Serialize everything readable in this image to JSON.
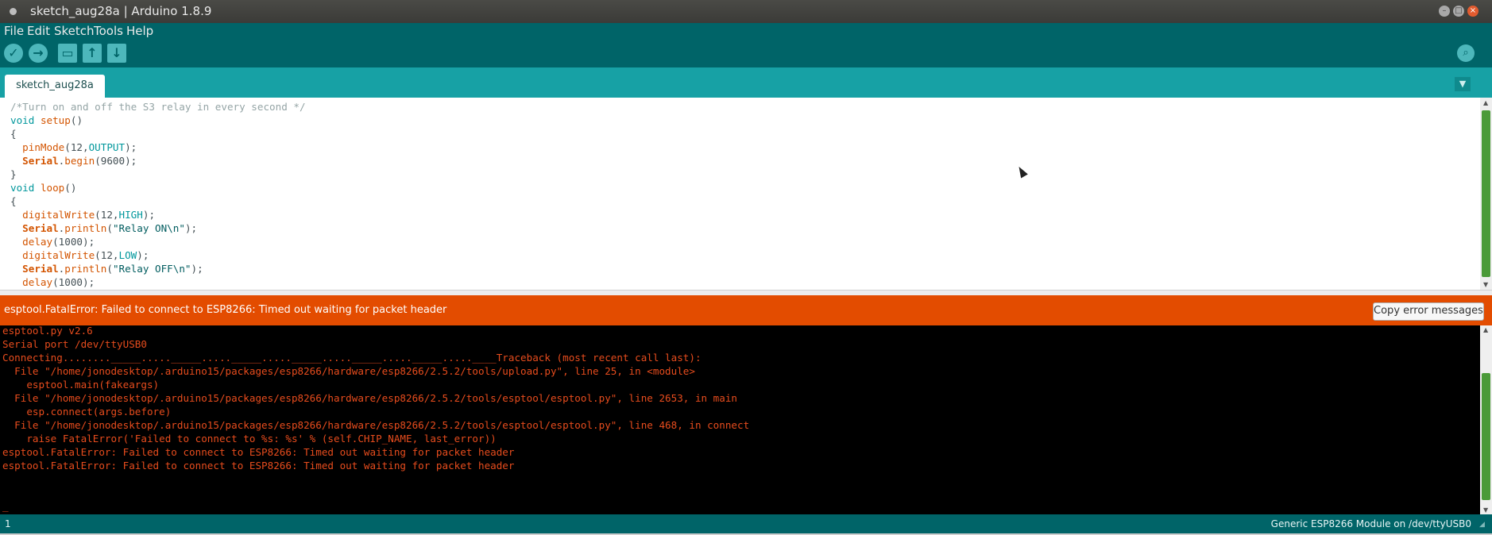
{
  "window": {
    "title": "sketch_aug28a | Arduino 1.8.9"
  },
  "window_controls": {
    "minimize": "–",
    "maximize": "□",
    "close": "×"
  },
  "menu": [
    {
      "label": "File"
    },
    {
      "label": "Edit"
    },
    {
      "label": "Sketch"
    },
    {
      "label": "Tools"
    },
    {
      "label": "Help"
    }
  ],
  "toolbar": {
    "verify_glyph": "✓",
    "upload_glyph": "→",
    "new_glyph": "▭",
    "open_glyph": "↑",
    "save_glyph": "↓",
    "serial_glyph": "⌕"
  },
  "tabs": {
    "active": "sketch_aug28a",
    "menu_glyph": "▼"
  },
  "editor": {
    "code_lines": [
      "/*Turn on and off the S3 relay in every second */",
      "void setup()",
      "{",
      "  pinMode(12,OUTPUT);",
      "  Serial.begin(9600);",
      "}",
      "void loop()",
      "{",
      "  digitalWrite(12,HIGH);",
      "  Serial.println(\"Relay ON\\n\");",
      "  delay(1000);",
      "  digitalWrite(12,LOW);",
      "  Serial.println(\"Relay OFF\\n\");",
      "  delay(1000);"
    ]
  },
  "error": {
    "message": "esptool.FatalError: Failed to connect to ESP8266: Timed out waiting for packet header",
    "copy_button": "Copy error messages"
  },
  "console": {
    "lines": [
      "esptool.py v2.6",
      "Serial port /dev/ttyUSB0",
      "Connecting........_____....._____....._____....._____....._____....._____.....____Traceback (most recent call last):",
      "  File \"/home/jonodesktop/.arduino15/packages/esp8266/hardware/esp8266/2.5.2/tools/upload.py\", line 25, in <module>",
      "    esptool.main(fakeargs)",
      "  File \"/home/jonodesktop/.arduino15/packages/esp8266/hardware/esp8266/2.5.2/tools/esptool/esptool.py\", line 2653, in main",
      "    esp.connect(args.before)",
      "  File \"/home/jonodesktop/.arduino15/packages/esp8266/hardware/esp8266/2.5.2/tools/esptool/esptool.py\", line 468, in connect",
      "    raise FatalError('Failed to connect to %s: %s' % (self.CHIP_NAME, last_error))",
      "esptool.FatalError: Failed to connect to ESP8266: Timed out waiting for packet header",
      "esptool.FatalError: Failed to connect to ESP8266: Timed out waiting for packet header",
      "",
      "",
      "_"
    ]
  },
  "status": {
    "line_number": "1",
    "board": "Generic ESP8266 Module on /dev/ttyUSB0"
  },
  "colors": {
    "teal_dark": "#006468",
    "teal_light": "#17a1a5",
    "error_orange": "#e34c00",
    "console_text": "#e74c1d"
  }
}
